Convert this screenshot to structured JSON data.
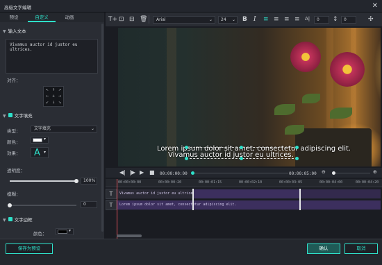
{
  "window": {
    "title": "高级文字编辑",
    "close_glyph": "✕"
  },
  "left_panel": {
    "tabs": [
      {
        "label": "预设"
      },
      {
        "label": "自定义"
      },
      {
        "label": "动画"
      }
    ],
    "active_tab": "自定义",
    "input_section": {
      "title": "输入文本",
      "text": "Vivamus auctor id justor eu ultrices."
    },
    "align_label": "对齐：",
    "fill_section": {
      "title": "文字填充",
      "type_label": "类型：",
      "type_value": "文字填充",
      "color_label": "颜色：",
      "effect_label": "效果：",
      "effect_glyph": "A",
      "opacity_label": "透明度：",
      "opacity_value": "100%",
      "opacity_level": 1.0,
      "blur_label": "模糊：",
      "blur_value": "0",
      "blur_level": 0
    },
    "border_section": {
      "title": "文字边框",
      "color_label": "颜色："
    }
  },
  "toolbar": {
    "font_value": "Arial",
    "size_value": "24",
    "spacing_value": "0",
    "line_height_value": "0",
    "bold_label": "B",
    "italic_label": "I"
  },
  "preview": {
    "line1": "Lorem ipsum dolor sit amet, consectetur adipiscing elit.",
    "line2": "Vivamus auctor id justor eu ultrices."
  },
  "playback": {
    "current_time": "00:00:00:00",
    "total_time": "00:00:05:00"
  },
  "timeline": {
    "ruler_labels": [
      "00:00:00:00",
      "00:00:00:20",
      "00:00:01:15",
      "00:00:02:10",
      "00:00:03:05",
      "00:00:04:00",
      "00:00:04:20"
    ],
    "tracks": [
      {
        "icon": "T",
        "clip_text": "Vivamus auctor id justor eu ultrices."
      },
      {
        "icon": "T",
        "clip_text": "Lorem ipsum dolor sit amet, consectetur adipiscing elit."
      }
    ]
  },
  "footer": {
    "save_preset_label": "保存为预设",
    "ok_label": "确认",
    "cancel_label": "取消"
  },
  "colors": {
    "accent": "#2ee0c9",
    "clip": "#3c2f5e",
    "playhead": "#e0525a",
    "fill_color": "#ffffff",
    "border_color": "#000000"
  }
}
